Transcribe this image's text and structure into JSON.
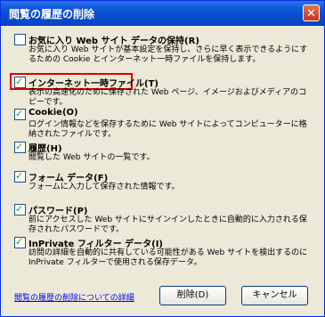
{
  "window": {
    "title": "閲覧の履歴の削除",
    "close_symbol": "✕"
  },
  "options": [
    {
      "label": "お気に入り Web サイト データの保持(R)",
      "checked": false,
      "desc": "お気に入り Web サイトが基本設定を保持し、さらに早く表示できるようにするための Cookie とインターネット一時ファイルを保持します。"
    },
    {
      "label": "インターネット一時ファイル(T)",
      "checked": true,
      "desc": "表示の高速化のために保存された Web ページ、イメージおよびメディアのコピーです。"
    },
    {
      "label": "Cookie(O)",
      "checked": true,
      "desc": "ログイン情報などを保存するために Web サイトによってコンピューターに格納されたファイルです。"
    },
    {
      "label": "履歴(H)",
      "checked": true,
      "desc": "閲覧した Web サイトの一覧です。"
    },
    {
      "label": "フォーム データ(F)",
      "checked": true,
      "desc": "フォームに入力して保存された情報です。"
    },
    {
      "label": "パスワード(P)",
      "checked": true,
      "desc": "前にアクセスした Web サイトにサインインしたときに自動的に入力される保存されたパスワードです。"
    },
    {
      "label": "InPrivate フィルター データ(I)",
      "checked": true,
      "desc": "訪問の詳細を自動的に共有している可能性がある Web サイトを検出するのに InPrivate フィルターで使用される保存データ。"
    }
  ],
  "footer": {
    "link": "閲覧の履歴の削除についての詳細",
    "delete_button": "削除(D)",
    "cancel_button": "キャンセル"
  },
  "colors": {
    "highlight": "#e00000",
    "titlebar": "#0a53d6",
    "face": "#ece9d8"
  }
}
